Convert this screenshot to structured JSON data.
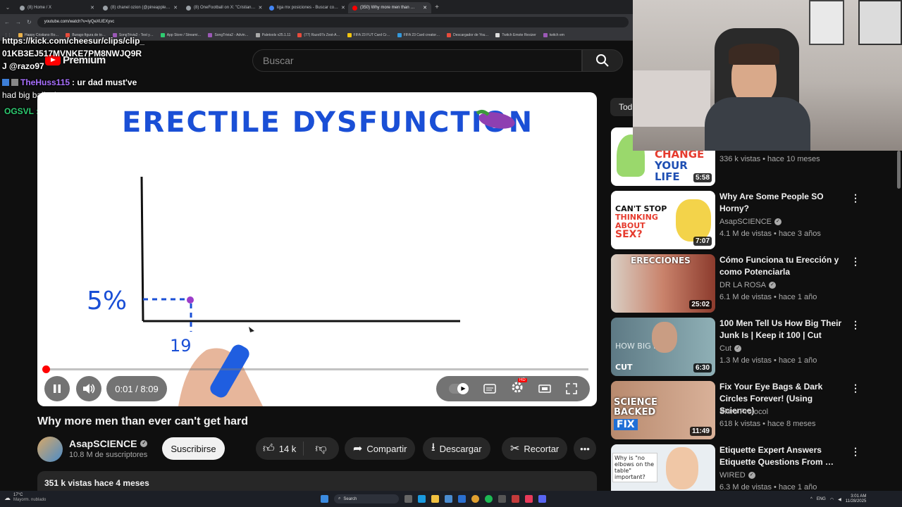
{
  "browser": {
    "tabs": [
      {
        "label": "(8) Home / X",
        "active": false
      },
      {
        "label": "(8) chanel ozion (@pineapple…",
        "active": false
      },
      {
        "label": "(8) OneFootball on X: \"Cristian…",
        "active": false
      },
      {
        "label": "liga mx posiciones - Buscar co…",
        "active": false
      },
      {
        "label": "(350) Why more men than …",
        "active": true
      }
    ],
    "url": "youtube.com/watch?v=IyQeXUEXyvc",
    "bookmarks": [
      "Happy Cristiano Ro…",
      "Burago figura de to…",
      "SongTrivia2 - Test y…",
      "App Store / Streami…",
      "SongTrivia2 - Advin…",
      "Paletools v25.1.11",
      "(77) Razo97s Zest-A…",
      "FIFA 23 FUT Card Cr…",
      "FIFA 23 Card creator…",
      "Descargador de You…",
      "Twitch Emote Resizer",
      "twitch em"
    ]
  },
  "youtube": {
    "logo_text": "Premium",
    "search_placeholder": "Buscar"
  },
  "chat": {
    "line1": "https://kick.com/cheesur/clips/clip_",
    "line2": "01KB3EJ517MVNKE7PM8NWJQ9R",
    "line3": "J @razo97",
    "msg_user": "TheHuss115",
    "msg_text": ": ur dad must've",
    "msg_text2": "had big balls then",
    "user2": "OGSVL :"
  },
  "video": {
    "whiteboard_title": "ERECTILE DYSFUNCTION",
    "y_label": "5%",
    "x_label": "19",
    "current_time": "0:01 / 8:09",
    "progress_fraction": 0.002,
    "title": "Why more men than ever can't get hard"
  },
  "channel": {
    "name": "AsapSCIENCE",
    "subscribers": "10.8 M de suscriptores",
    "subscribe_label": "Suscribirse"
  },
  "actions": {
    "likes": "14 k",
    "share": "Compartir",
    "download": "Descargar",
    "clip": "Recortar"
  },
  "description": {
    "meta": "351 k vistas  hace 4 meses"
  },
  "sidebar": {
    "chip": "Tod",
    "recommendations": [
      {
        "title": "",
        "channel": "",
        "meta": "336 k vistas • hace 10 meses",
        "duration": "5:58",
        "thumb_text": "CHANGE YOUR LIFE"
      },
      {
        "title": "Why Are Some People SO Horny?",
        "channel": "AsapSCIENCE",
        "meta": "4.1 M de vistas • hace 3 años",
        "duration": "7:07",
        "thumb_text": "CAN'T STOP THINKING ABOUT SEX?"
      },
      {
        "title": "Cómo Funciona tu Erección y como Potenciarla",
        "channel": "DR LA ROSA",
        "meta": "6.1 M de vistas • hace 1 año",
        "duration": "25:02",
        "thumb_text": "ERECCIONES"
      },
      {
        "title": "100 Men Tell Us How Big Their Junk Is | Keep it 100 | Cut",
        "channel": "Cut",
        "meta": "1.3 M de vistas • hace 1 año",
        "duration": "6:30",
        "thumb_text": "HOW BIG IS IT?"
      },
      {
        "title": "Fix Your Eye Bags & Dark Circles Forever! (Using Science)",
        "channel": "Shiro Protocol",
        "meta": "618 k vistas • hace 8 meses",
        "duration": "11:49",
        "thumb_text": "SCIENCE BACKED FIX"
      },
      {
        "title": "Etiquette Expert Answers Etiquette Questions From …",
        "channel": "WIRED",
        "meta": "6.3 M de vistas • hace 1 año",
        "duration": "",
        "thumb_text": "Why is \"no elbows on the table\" important?"
      }
    ]
  },
  "taskbar": {
    "weather_temp": "17°C",
    "weather_desc": "Mayorm. nublado",
    "search": "Search",
    "lang": "ENG",
    "time": "3:01 AM",
    "date": "11/28/2025"
  },
  "colors": {
    "bg": "#0f0f0f",
    "youtube_red": "#ff0000",
    "marker_blue": "#1a4fd6",
    "chat_user": "#a970ff",
    "chat_user2": "#2ecc71"
  }
}
